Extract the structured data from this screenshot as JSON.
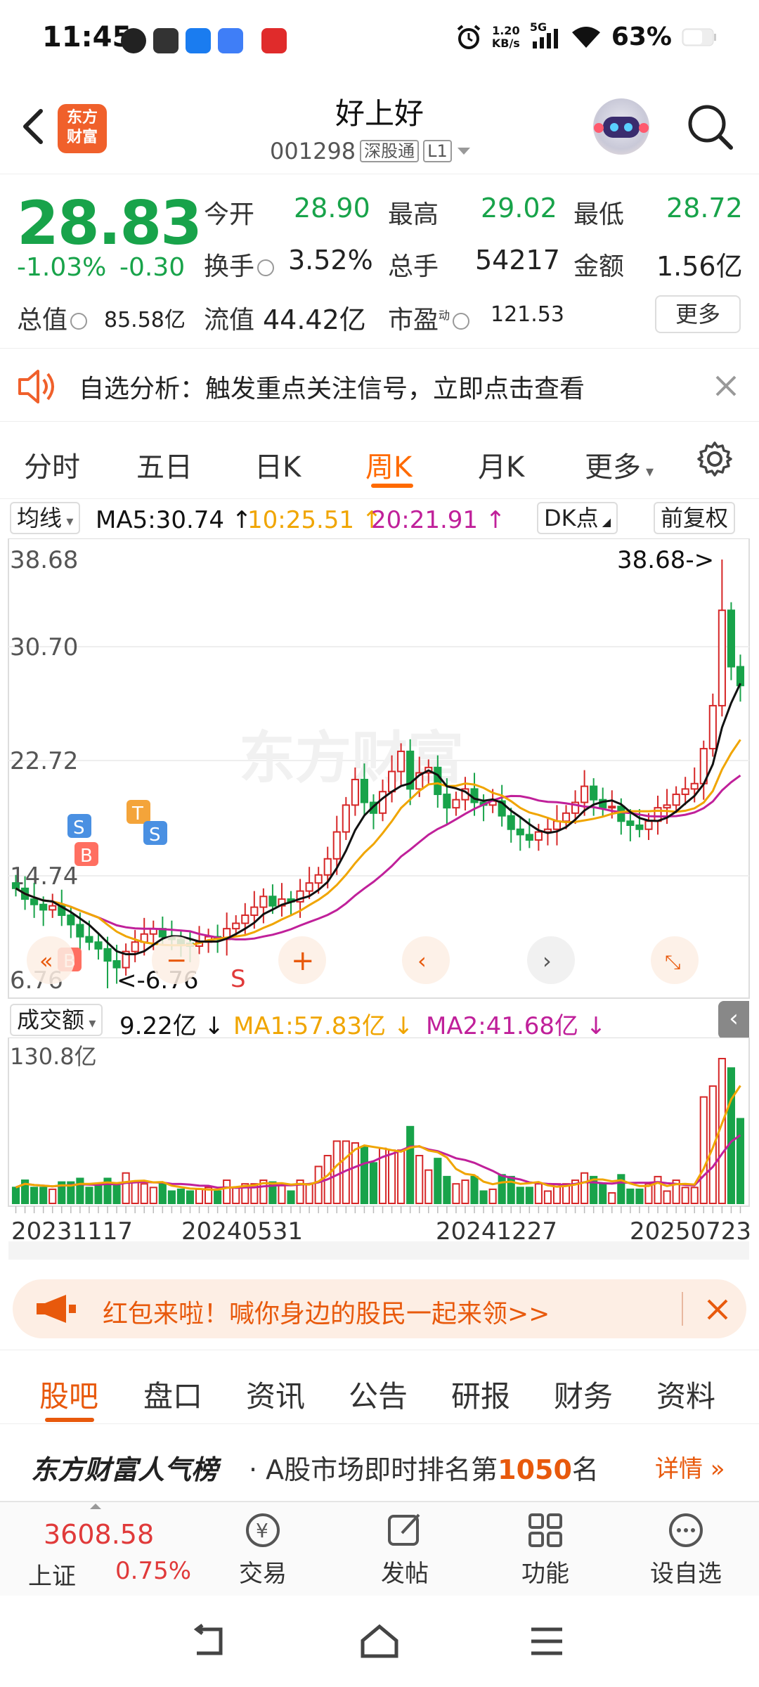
{
  "status_bar": {
    "time": "11:45",
    "net_speed_value": "1.20",
    "net_speed_unit": "KB/s",
    "network": "5G",
    "battery": "63%"
  },
  "header": {
    "logo_text_line1": "东方",
    "logo_text_line2": "财富",
    "stock_name": "好上好",
    "stock_code": "001298",
    "tag_connect": "深股通",
    "tag_level": "L1"
  },
  "quote": {
    "price": "28.83",
    "change_pct": "-1.03%",
    "change": "-0.30",
    "open_label": "今开",
    "open_value": "28.90",
    "high_label": "最高",
    "high_value": "29.02",
    "low_label": "最低",
    "low_value": "28.72",
    "turnover_label": "换手",
    "turnover_value": "3.52%",
    "volume_label": "总手",
    "volume_value": "54217",
    "amount_label": "金额",
    "amount_value": "1.56亿",
    "mktcap_label": "总值",
    "mktcap_value": "85.58亿",
    "float_label": "流值",
    "float_value": "44.42亿",
    "pe_label": "市盈",
    "pe_sup": "动",
    "pe_value": "121.53",
    "more_label": "更多"
  },
  "signal": {
    "text": "自选分析：触发重点关注信号，立即点击查看"
  },
  "kline_tabs": [
    {
      "label": "分时"
    },
    {
      "label": "五日"
    },
    {
      "label": "日K"
    },
    {
      "label": "周K"
    },
    {
      "label": "月K"
    },
    {
      "label": "更多"
    }
  ],
  "ma": {
    "selector": "均线",
    "ma5": "MA5:30.74",
    "ma10": "10:25.51",
    "ma20": "20:21.91",
    "dk_label": "DK点",
    "fq_label": "前复权",
    "colors": {
      "ma5": "#111111",
      "ma10": "#f0a500",
      "ma20": "#c0209a",
      "up": "#d62728",
      "down": "#18a34a"
    }
  },
  "chart_data": {
    "type": "candlestick",
    "title": "",
    "price_axis_ticks": [
      "38.68",
      "30.70",
      "22.72",
      "14.74",
      "6.76"
    ],
    "ylim": [
      6.76,
      38.68
    ],
    "max_label": "38.68->",
    "min_label": "<-6.76",
    "date_ticks": [
      "20231117",
      "20240531",
      "20241227",
      "20250723"
    ],
    "closes": [
      14.2,
      13.4,
      13.0,
      12.6,
      12.9,
      12.2,
      11.5,
      10.6,
      10.2,
      9.7,
      8.8,
      8.3,
      9.5,
      10.2,
      10.8,
      11.2,
      10.6,
      10.4,
      10.1,
      9.9,
      10.2,
      10.6,
      10.4,
      11.2,
      11.6,
      12.2,
      12.8,
      13.6,
      12.9,
      13.4,
      13.2,
      14.0,
      14.6,
      15.2,
      16.4,
      18.4,
      20.4,
      22.3,
      20.6,
      19.8,
      21.4,
      22.9,
      24.4,
      21.6,
      22.8,
      23.2,
      21.2,
      20.2,
      20.8,
      21.6,
      20.6,
      20.4,
      20.7,
      19.6,
      18.6,
      18.2,
      17.8,
      18.4,
      18.6,
      19.2,
      19.8,
      20.6,
      21.8,
      20.8,
      20.2,
      20.3,
      19.2,
      18.9,
      18.6,
      19.2,
      20.2,
      20.4,
      21.2,
      21.6,
      22.0,
      24.6,
      27.8,
      34.9,
      30.7,
      29.3
    ],
    "volume_ylim_label": "130.8亿",
    "volume_summary": "9.22亿",
    "volume_ma1": "MA1:57.83亿",
    "volume_ma2": "MA2:41.68亿",
    "markers": [
      "S",
      "B",
      "T",
      "S",
      "B",
      "S"
    ]
  },
  "vol": {
    "selector": "成交额",
    "value": "9.22亿",
    "ma1": "MA1:57.83亿",
    "ma2": "MA2:41.68亿"
  },
  "banner": {
    "text": "红包来啦！喊你身边的股民一起来领>>"
  },
  "bottom_tabs": [
    {
      "label": "股吧"
    },
    {
      "label": "盘口"
    },
    {
      "label": "资讯"
    },
    {
      "label": "公告"
    },
    {
      "label": "研报"
    },
    {
      "label": "财务"
    },
    {
      "label": "资料"
    }
  ],
  "rank": {
    "title": "东方财富人气榜",
    "prefix": "· A股市场即时排名第",
    "number": "1050",
    "suffix": "名",
    "detail": "详情"
  },
  "bottom_nav": {
    "index_value": "3608.58",
    "index_name": "上证",
    "index_change": "0.75%",
    "items": [
      {
        "label": "交易"
      },
      {
        "label": "发帖"
      },
      {
        "label": "功能"
      },
      {
        "label": "设自选"
      }
    ]
  },
  "watermark": "东方财富"
}
